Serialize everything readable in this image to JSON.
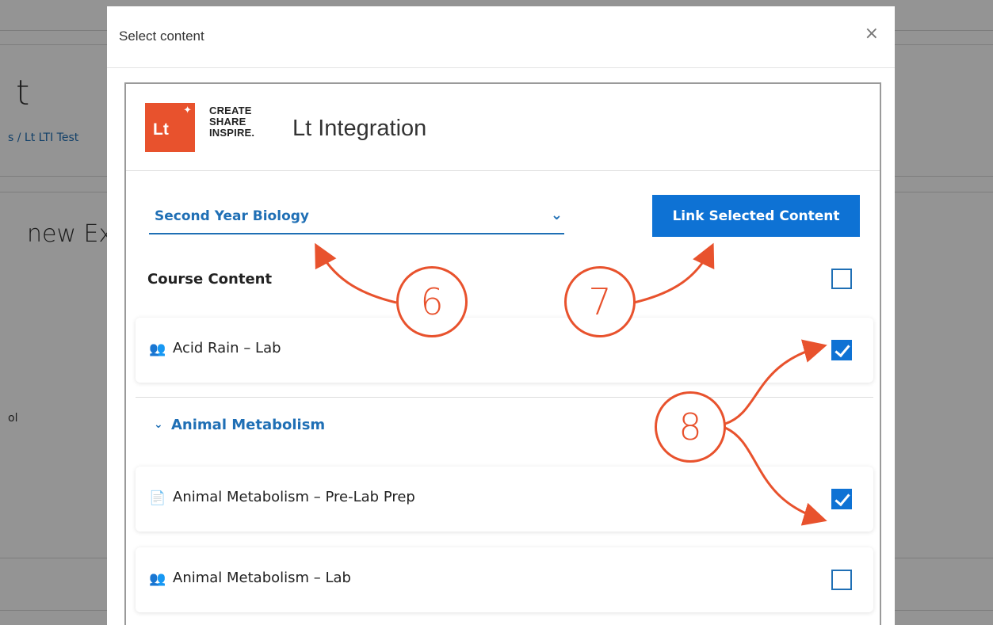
{
  "background": {
    "title_fragment": "t",
    "breadcrumb_fragment": "s / Lt LTI Test",
    "heading_fragment": "new Ext",
    "label_fragment": "ol"
  },
  "modal": {
    "title": "Select content",
    "close_glyph": "×"
  },
  "tool": {
    "logo_text": "Lt",
    "tagline": [
      "CREATE",
      "SHARE",
      "INSPIRE."
    ],
    "title": "Lt Integration",
    "selected_course": "Second Year Biology",
    "link_button": "Link Selected Content",
    "section_label": "Course Content",
    "section_checked": false,
    "items": [
      {
        "label": "Acid Rain – Lab",
        "icon": "group-icon",
        "checked": true
      },
      {
        "label": "Animal Metabolism – Pre-Lab Prep",
        "icon": "document-icon",
        "checked": true
      },
      {
        "label": "Animal Metabolism – Lab",
        "icon": "group-icon",
        "checked": false
      }
    ],
    "folder": {
      "name": "Animal Metabolism",
      "expanded": true
    }
  },
  "annotations": {
    "step6": "6",
    "step7": "7",
    "step8": "8"
  },
  "colors": {
    "accent": "#0e72d4",
    "link_blue": "#1f6fb5",
    "brand_orange": "#e8522d"
  }
}
